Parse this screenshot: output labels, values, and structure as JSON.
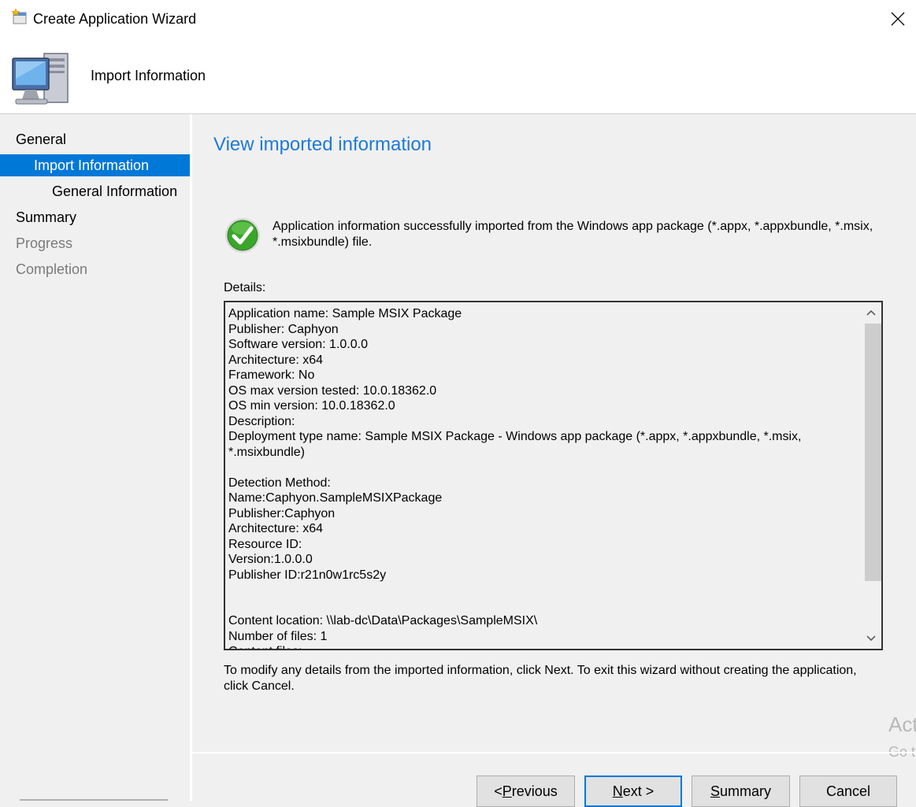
{
  "window": {
    "title": "Create Application Wizard",
    "close_icon": "close-icon"
  },
  "header": {
    "title": "Import Information",
    "icon": "computer-icon"
  },
  "sidebar": {
    "items": [
      {
        "label": "General",
        "level": 0,
        "state": "normal"
      },
      {
        "label": "Import Information",
        "level": 1,
        "state": "selected"
      },
      {
        "label": "General Information",
        "level": 2,
        "state": "normal"
      },
      {
        "label": "Summary",
        "level": 0,
        "state": "normal"
      },
      {
        "label": "Progress",
        "level": 0,
        "state": "disabled"
      },
      {
        "label": "Completion",
        "level": 0,
        "state": "disabled"
      }
    ]
  },
  "main": {
    "heading": "View imported information",
    "success_icon": "check-icon",
    "success_message": "Application information successfully imported from the Windows app package (*.appx, *.appxbundle, *.msix, *.msixbundle) file.",
    "details_label": "Details:",
    "details_lines": [
      "Application name: Sample MSIX Package",
      "Publisher: Caphyon",
      "Software version: 1.0.0.0",
      "Architecture: x64",
      "Framework: No",
      "OS max version tested: 10.0.18362.0",
      "OS min version: 10.0.18362.0",
      "Description:",
      "Deployment type name: Sample MSIX Package - Windows app package (*.appx, *.appxbundle, *.msix,",
      "*.msixbundle)",
      "",
      "Detection Method:",
      "Name:Caphyon.SampleMSIXPackage",
      "Publisher:Caphyon",
      "Architecture: x64",
      "Resource ID:",
      "Version:1.0.0.0",
      "Publisher ID:r21n0w1rc5s2y",
      "",
      "",
      "Content location: \\\\lab-dc\\Data\\Packages\\SampleMSIX\\",
      "Number of files: 1",
      "Content files:"
    ],
    "footer_note": "To modify any details from the imported information, click Next. To exit this wizard without creating the application, click Cancel."
  },
  "watermark": {
    "line1": "Act",
    "line2": "Go t"
  },
  "buttons": {
    "previous": {
      "pre": "< ",
      "accel": "P",
      "post": "revious"
    },
    "next": {
      "pre": "",
      "accel": "N",
      "post": "ext >"
    },
    "summary": {
      "pre": "",
      "accel": "S",
      "post": "ummary"
    },
    "cancel": {
      "label": "Cancel"
    }
  },
  "colors": {
    "accent": "#0078d7",
    "heading": "#1e7ad6",
    "success": "#3aa52b"
  }
}
